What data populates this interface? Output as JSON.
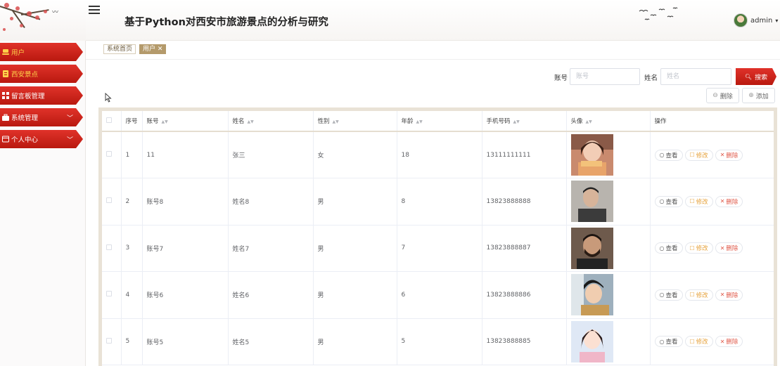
{
  "app": {
    "title": "基于Python对西安市旅游景点的分析与研究"
  },
  "user": {
    "name": "admin",
    "caret": "▾"
  },
  "sidebar": {
    "items": [
      {
        "label": "用户",
        "icon": "user-icon",
        "active": true,
        "has_arrow": false
      },
      {
        "label": "西安景点",
        "icon": "document-icon",
        "active": false,
        "has_arrow": false
      },
      {
        "label": "留言板管理",
        "icon": "grid-icon",
        "active": false,
        "has_arrow": false
      },
      {
        "label": "系统管理",
        "icon": "briefcase-icon",
        "active": false,
        "has_arrow": true
      },
      {
        "label": "个人中心",
        "icon": "profile-card-icon",
        "active": false,
        "has_arrow": true
      }
    ]
  },
  "tabs": [
    {
      "label": "系统首页",
      "active": false
    },
    {
      "label": "用户 ✕",
      "active": true
    }
  ],
  "search": {
    "account_label": "账号",
    "account_placeholder": "账号",
    "name_label": "姓名",
    "name_placeholder": "姓名",
    "button_label": "搜索"
  },
  "actions": {
    "delete_label": "删除",
    "add_label": "添加"
  },
  "table": {
    "columns": [
      "序号",
      "账号",
      "姓名",
      "性别",
      "年龄",
      "手机号码",
      "头像",
      "操作"
    ],
    "row_actions": {
      "view": "查看",
      "edit": "修改",
      "delete": "删除"
    },
    "rows": [
      {
        "index": "1",
        "account": "11",
        "name": "张三",
        "gender": "女",
        "age": "18",
        "phone": "13111111111",
        "avatar": "photo-woman-eating"
      },
      {
        "index": "2",
        "account": "账号8",
        "name": "姓名8",
        "gender": "男",
        "age": "8",
        "phone": "13823888888",
        "avatar": "photo-man-grey"
      },
      {
        "index": "3",
        "account": "账号7",
        "name": "姓名7",
        "gender": "男",
        "age": "7",
        "phone": "13823888887",
        "avatar": "photo-man-beard"
      },
      {
        "index": "4",
        "account": "账号6",
        "name": "姓名6",
        "gender": "男",
        "age": "6",
        "phone": "13823888886",
        "avatar": "photo-young-man"
      },
      {
        "index": "5",
        "account": "账号5",
        "name": "姓名5",
        "gender": "男",
        "age": "5",
        "phone": "13823888885",
        "avatar": "photo-girl-pink"
      }
    ]
  },
  "colors": {
    "menu_red": "#c4201a",
    "active_menu_text": "#ffd24a",
    "active_tab": "#b49a6b",
    "edit_orange": "#e6a23c",
    "delete_red": "#e05a4a"
  }
}
